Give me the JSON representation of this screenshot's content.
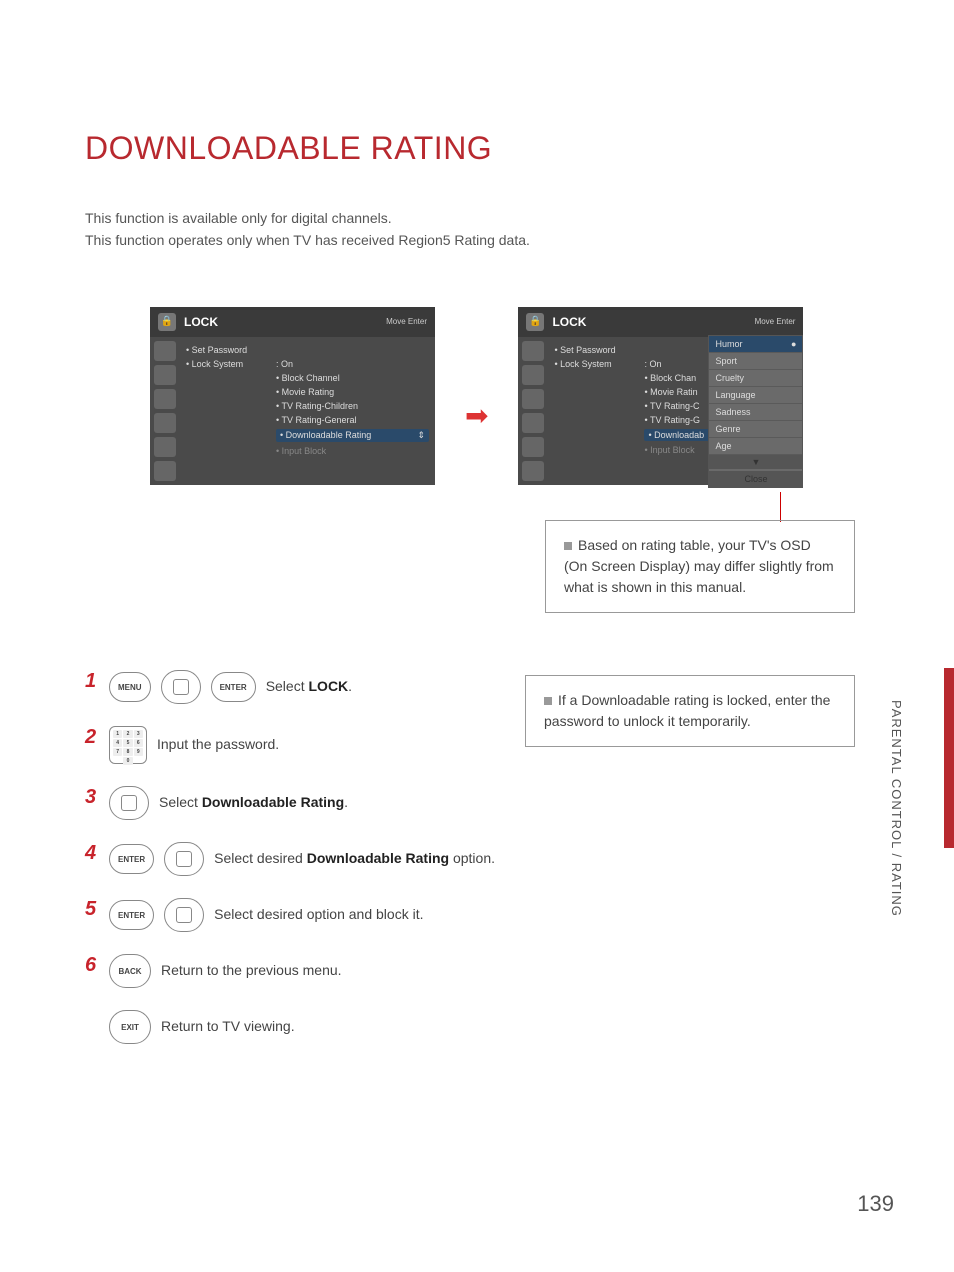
{
  "title": "DOWNLOADABLE RATING",
  "intro": {
    "line1": "This function is available only for digital channels.",
    "line2": "This function operates only when TV has received Region5 Rating data."
  },
  "osd": {
    "header_title": "LOCK",
    "header_hint": "Move    Enter",
    "items": {
      "set_password": "Set Password",
      "lock_system": "Lock System",
      "lock_system_val": ": On",
      "block_channel": "Block Channel",
      "movie_rating": "Movie Rating",
      "tv_children": "TV Rating-Children",
      "tv_general": "TV Rating-General",
      "downloadable": "Downloadable Rating",
      "input_block": "Input Block"
    }
  },
  "popup": {
    "humor": "Humor",
    "sport": "Sport",
    "cruelty": "Cruelty",
    "language": "Language",
    "sadness": "Sadness",
    "genre": "Genre",
    "age": "Age",
    "close": "Close"
  },
  "note1": "Based on rating table, your TV's OSD (On Screen Display) may differ slightly from what is shown in this manual.",
  "note2": "If a Downloadable rating is locked, enter the password to unlock it temporarily.",
  "steps": {
    "s1": {
      "btn1": "MENU",
      "btn2_arrows": "< >",
      "btn3": "ENTER",
      "text_pre": "Select ",
      "text_b": "LOCK",
      "text_post": "."
    },
    "s2": {
      "text": "Input the password."
    },
    "s3": {
      "text_pre": "Select ",
      "text_b": "Downloadable Rating",
      "text_post": "."
    },
    "s4": {
      "btn": "ENTER",
      "text_pre": "Select desired ",
      "text_b": "Downloadable Rating",
      "text_post": " option."
    },
    "s5": {
      "btn": "ENTER",
      "text": "Select desired option and block it."
    },
    "s6": {
      "btn": "BACK",
      "text": "Return to the previous menu."
    },
    "s7": {
      "btn": "EXIT",
      "text": "Return to TV viewing."
    }
  },
  "side_label": "PARENTAL CONTROL / RATING",
  "page_number": "139"
}
